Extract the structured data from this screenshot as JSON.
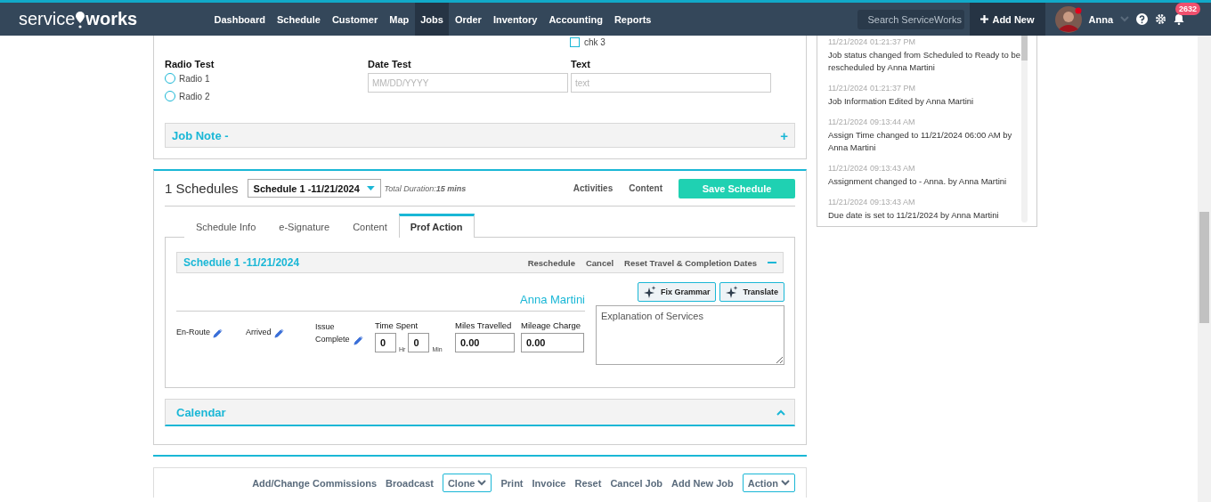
{
  "header": {
    "logo": {
      "left": "service",
      "right": "works"
    },
    "nav": [
      {
        "label": "Dashboard",
        "selected": false
      },
      {
        "label": "Schedule",
        "selected": false
      },
      {
        "label": "Customer",
        "selected": false
      },
      {
        "label": "Map",
        "selected": false
      },
      {
        "label": "Jobs",
        "selected": true
      },
      {
        "label": "Order",
        "selected": false
      },
      {
        "label": "Inventory",
        "selected": false
      },
      {
        "label": "Accounting",
        "selected": false
      },
      {
        "label": "Reports",
        "selected": false
      }
    ],
    "search": {
      "placeholder": "Search ServiceWorks"
    },
    "add_new": "Add New",
    "user": "Anna",
    "notifications": "2632"
  },
  "custom_fields": {
    "checkbox": {
      "label": "chk 3",
      "checked": false
    },
    "radio_test": {
      "label": "Radio Test",
      "options": [
        {
          "label": "Radio 1",
          "selected": false
        },
        {
          "label": "Radio 2",
          "selected": false
        }
      ]
    },
    "date_test": {
      "label": "Date Test",
      "placeholder": "MM/DD/YYYY"
    },
    "text": {
      "label": "Text",
      "placeholder": "text"
    },
    "job_note": {
      "label": "Job Note -",
      "toggle": "+"
    }
  },
  "schedules": {
    "title": "1 Schedules",
    "selector": "Schedule 1 -11/21/2024",
    "duration_label": "Total Duration:",
    "duration": "15 mins",
    "links": [
      "Activities",
      "Content"
    ],
    "save": "Save Schedule",
    "tabs": [
      {
        "label": "Schedule Info",
        "selected": false
      },
      {
        "label": "e-Signature",
        "selected": false
      },
      {
        "label": "Content",
        "selected": false
      },
      {
        "label": "Prof Action",
        "selected": true
      }
    ],
    "panel": {
      "title": "Schedule 1 -11/21/2024",
      "actions": [
        "Reschedule",
        "Cancel",
        "Reset Travel & Completion Dates"
      ],
      "technician": "Anna Martini",
      "ai_buttons": [
        "Fix Grammar",
        "Translate"
      ],
      "statuses": [
        {
          "label": "En-Route"
        },
        {
          "label": "Arrived"
        },
        {
          "label": "Issue Complete"
        }
      ],
      "time_spent": {
        "label": "Time Spent",
        "hours": "0",
        "hours_unit": "Hr",
        "minutes": "0",
        "minutes_unit": "Min"
      },
      "miles": {
        "label": "Miles Travelled",
        "value": "0.00"
      },
      "mileage": {
        "label": "Mileage Charge",
        "value": "0.00"
      },
      "explanation": {
        "placeholder": "Explanation of Services"
      }
    },
    "calendar": {
      "label": "Calendar",
      "expanded": true
    }
  },
  "footer": [
    {
      "label": "Add/Change Commissions",
      "kind": "link"
    },
    {
      "label": "Broadcast",
      "kind": "link"
    },
    {
      "label": "Clone",
      "kind": "dropdown"
    },
    {
      "label": "Print",
      "kind": "link"
    },
    {
      "label": "Invoice",
      "kind": "link"
    },
    {
      "label": "Reset",
      "kind": "link"
    },
    {
      "label": "Cancel Job",
      "kind": "link"
    },
    {
      "label": "Add New Job",
      "kind": "link"
    },
    {
      "label": "Action",
      "kind": "dropdown"
    }
  ],
  "activity_log": [
    {
      "time": "11/21/2024 01:21:37 PM",
      "text": "Job status changed from Scheduled to Ready to be rescheduled by Anna Martini"
    },
    {
      "time": "11/21/2024 01:21:37 PM",
      "text": "Job Information Edited by Anna Martini"
    },
    {
      "time": "11/21/2024 09:13:44 AM",
      "text": "Assign Time changed to 11/21/2024 06:00 AM by Anna Martini"
    },
    {
      "time": "11/21/2024 09:13:43 AM",
      "text": "Assignment changed to - Anna. by Anna Martini"
    },
    {
      "time": "11/21/2024 09:13:43 AM",
      "text": "Due date is set to 11/21/2024 by Anna Martini"
    }
  ]
}
